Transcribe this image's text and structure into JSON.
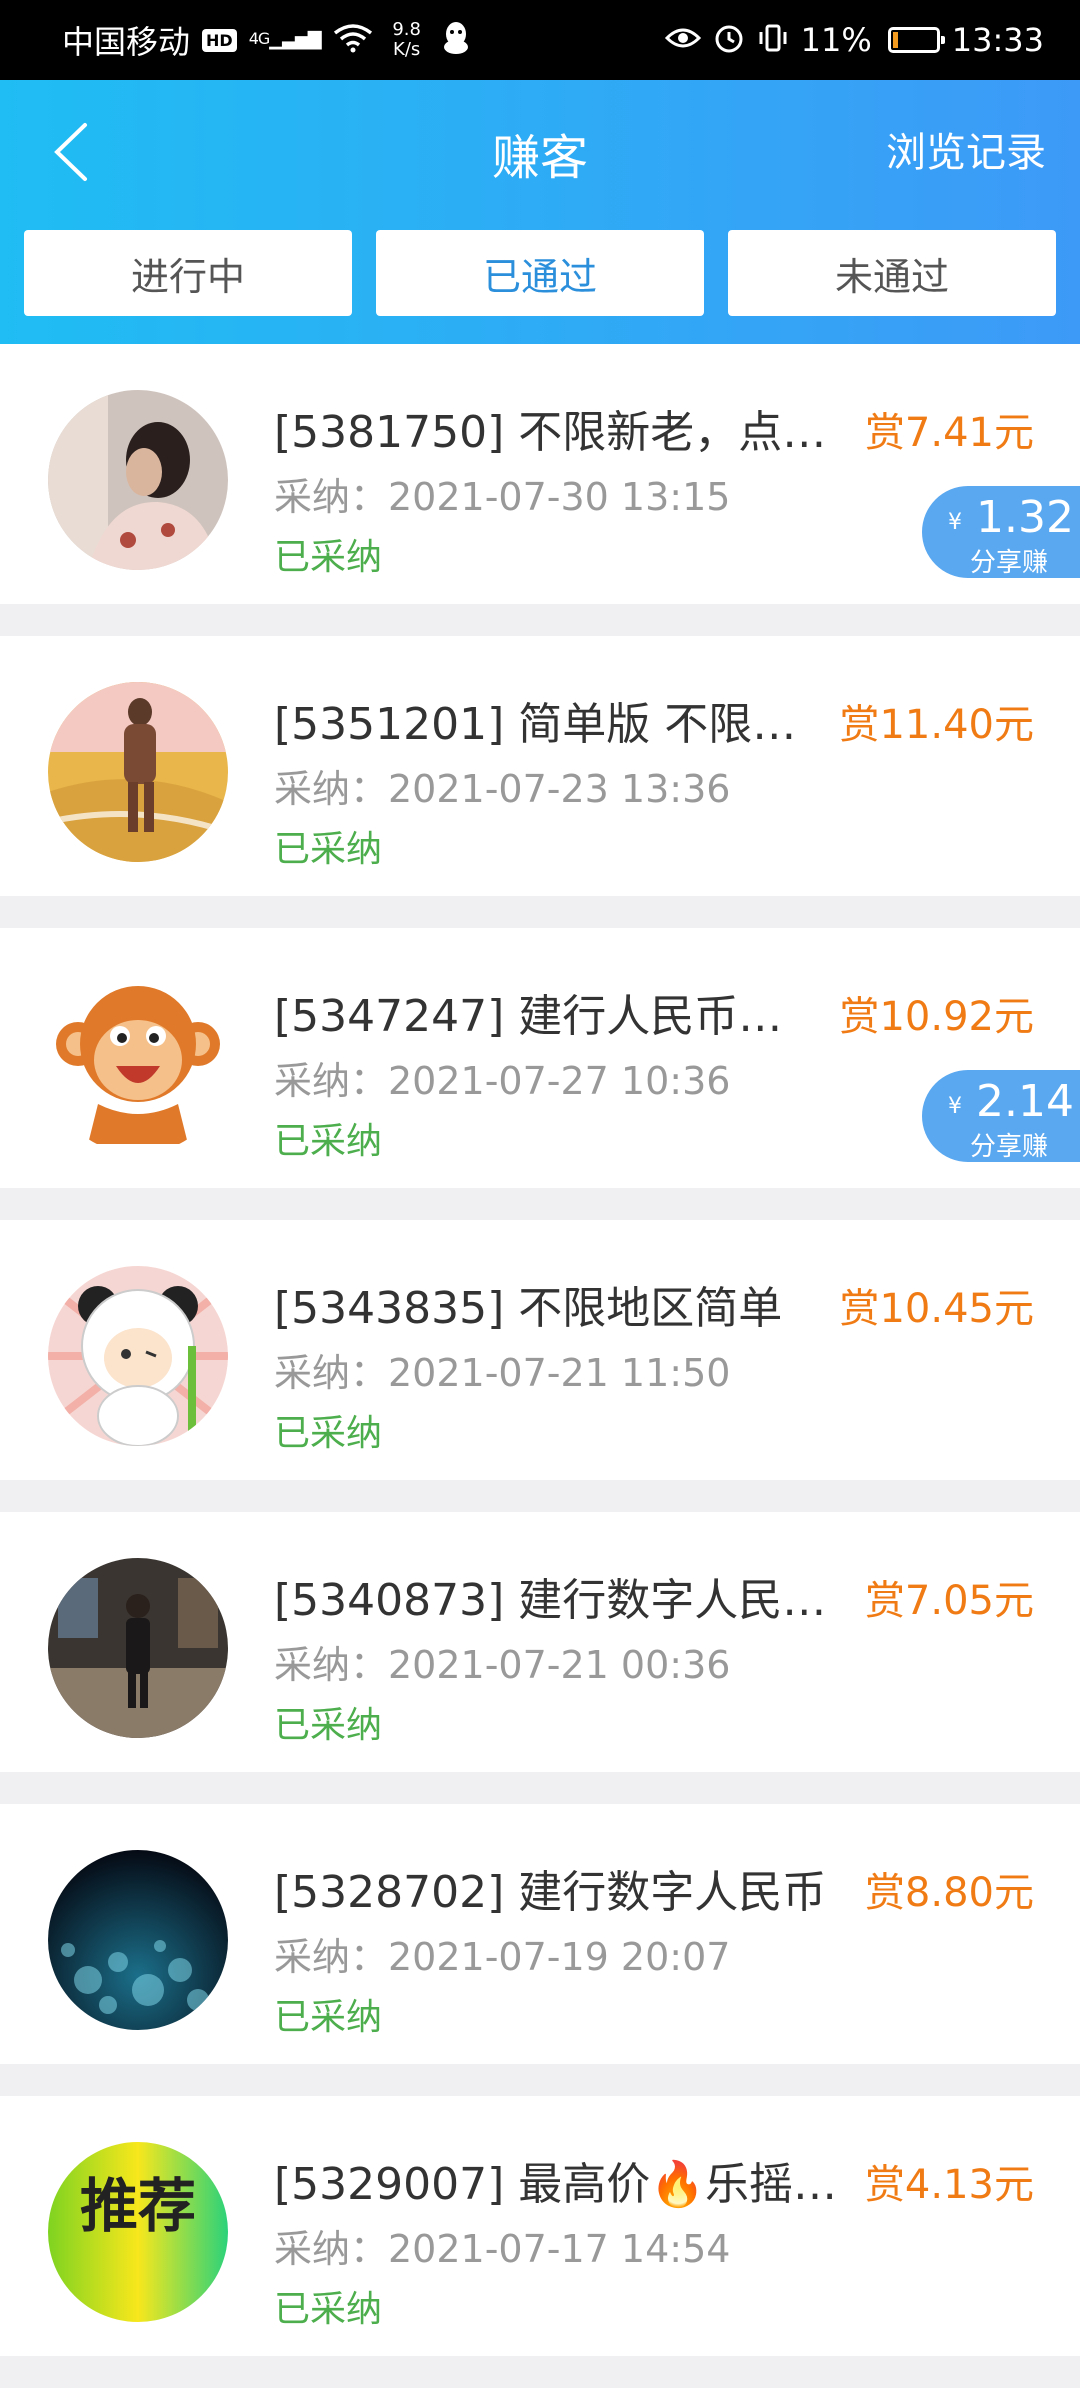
{
  "status_bar": {
    "carrier": "中国移动",
    "hd": "HD",
    "network": "4G",
    "speed_value": "9.8",
    "speed_unit": "K/s",
    "battery": "11%",
    "battery_level": 0.11,
    "time": "13:33"
  },
  "header": {
    "title": "赚客",
    "history_label": "浏览记录"
  },
  "tabs": [
    {
      "label": "进行中",
      "active": false
    },
    {
      "label": "已通过",
      "active": true
    },
    {
      "label": "未通过",
      "active": false
    }
  ],
  "items": [
    {
      "title": "[5381750] 不限新老，点…",
      "reward": "赏7.41元",
      "date": "采纳：2021-07-30 13:15",
      "status": "已采纳",
      "avatar": "photo-avatar-woman",
      "share_yen": "¥",
      "share_amount": "1.32",
      "share_label": "分享赚"
    },
    {
      "title": "[5351201] 简单版 不限…",
      "reward": "赏11.40元",
      "date": "采纳：2021-07-23 13:36",
      "status": "已采纳",
      "avatar": "photo-avatar-beach"
    },
    {
      "title": "[5347247] 建行人民币…",
      "reward": "赏10.92元",
      "date": "采纳：2021-07-27 10:36",
      "status": "已采纳",
      "avatar": "monkey-avatar",
      "share_yen": "¥",
      "share_amount": "2.14",
      "share_label": "分享赚"
    },
    {
      "title": "[5343835] 不限地区简单",
      "reward": "赏10.45元",
      "date": "采纳：2021-07-21 11:50",
      "status": "已采纳",
      "avatar": "panda-avatar"
    },
    {
      "title": "[5340873] 建行数字人民…",
      "reward": "赏7.05元",
      "date": "采纳：2021-07-21 00:36",
      "status": "已采纳",
      "avatar": "photo-avatar-mall"
    },
    {
      "title": "[5328702] 建行数字人民币",
      "reward": "赏8.80元",
      "date": "采纳：2021-07-19 20:07",
      "status": "已采纳",
      "avatar": "bokeh-avatar"
    },
    {
      "title": "[5329007] 最高价🔥乐摇…",
      "reward": "赏4.13元",
      "date": "采纳：2021-07-17 14:54",
      "status": "已采纳",
      "avatar": "recommend-avatar",
      "avatar_text": "推荐"
    }
  ]
}
